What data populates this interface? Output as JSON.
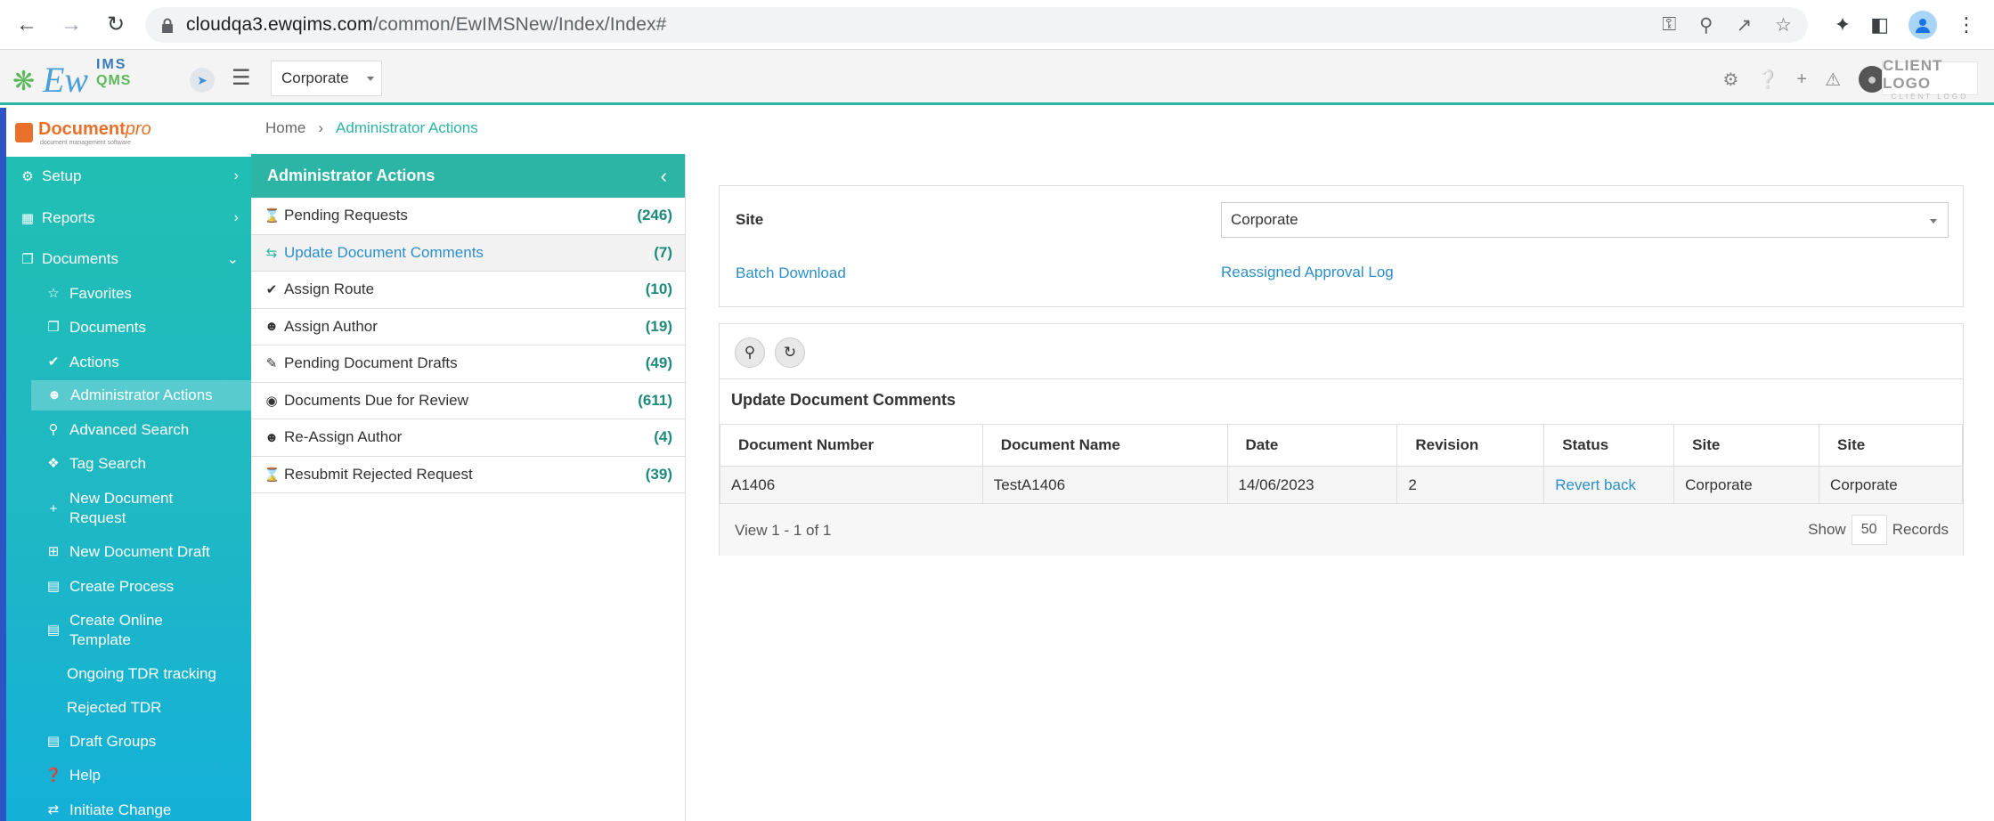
{
  "browser": {
    "url_host": "cloudqa3.ewqims.com",
    "url_path": "/common/EwIMSNew/Index/Index#"
  },
  "header": {
    "logo_ew": "Ew",
    "logo_ims": "IMS",
    "logo_qms": "QMS",
    "site_selected": "Corporate",
    "client_logo": "CLIENT LOGO",
    "client_logo_sub": "CLIENT LOGO"
  },
  "sidebar": {
    "brand_name": "Document",
    "brand_suffix": "pro",
    "brand_sub": "document management software",
    "items": [
      {
        "label": "Setup",
        "icon": "cogs-icon"
      },
      {
        "label": "Reports",
        "icon": "building-icon"
      },
      {
        "label": "Documents",
        "icon": "copy-icon"
      }
    ],
    "subitems": [
      {
        "label": "Favorites",
        "icon": "star-icon"
      },
      {
        "label": "Documents",
        "icon": "copy-icon"
      },
      {
        "label": "Actions",
        "icon": "check-icon"
      },
      {
        "label": "Administrator Actions",
        "icon": "user-check-icon"
      },
      {
        "label": "Advanced Search",
        "icon": "search-icon"
      },
      {
        "label": "Tag Search",
        "icon": "tags-icon"
      },
      {
        "label": "New Document Request",
        "icon": "plus-icon"
      },
      {
        "label": "New Document Draft",
        "icon": "plus-square-icon"
      },
      {
        "label": "Create Process",
        "icon": "list-icon"
      },
      {
        "label": "Create Online Template",
        "icon": "list-icon"
      },
      {
        "label": "Ongoing TDR tracking",
        "icon": ""
      },
      {
        "label": "Rejected TDR",
        "icon": ""
      },
      {
        "label": "Draft Groups",
        "icon": "list-icon"
      },
      {
        "label": "Help",
        "icon": "question-icon"
      },
      {
        "label": "Initiate Change",
        "icon": "change-icon"
      }
    ]
  },
  "breadcrumb": {
    "home": "Home",
    "current": "Administrator Actions"
  },
  "admin_panel": {
    "title": "Administrator Actions",
    "rows": [
      {
        "label": "Pending Requests",
        "count": "(246)"
      },
      {
        "label": "Update Document Comments",
        "count": "(7)"
      },
      {
        "label": "Assign Route",
        "count": "(10)"
      },
      {
        "label": "Assign Author",
        "count": "(19)"
      },
      {
        "label": "Pending Document Drafts",
        "count": "(49)"
      },
      {
        "label": "Documents Due for Review",
        "count": "(611)"
      },
      {
        "label": "Re-Assign Author",
        "count": "(4)"
      },
      {
        "label": "Resubmit Rejected Request",
        "count": "(39)"
      }
    ]
  },
  "filter": {
    "site_label": "Site",
    "site_value": "Corporate",
    "batch_download": "Batch Download",
    "reassigned_log": "Reassigned Approval Log"
  },
  "grid": {
    "title": "Update Document Comments",
    "columns": [
      "Document Number",
      "Document Name",
      "Date",
      "Revision",
      "Status",
      "Site",
      "Site"
    ],
    "rows": [
      [
        "A1406",
        "TestA1406",
        "14/06/2023",
        "2",
        "Revert back",
        "Corporate",
        "Corporate"
      ]
    ],
    "pager_text": "View 1 - 1 of 1",
    "show_label": "Show",
    "page_size": "50",
    "records_label": "Records"
  }
}
